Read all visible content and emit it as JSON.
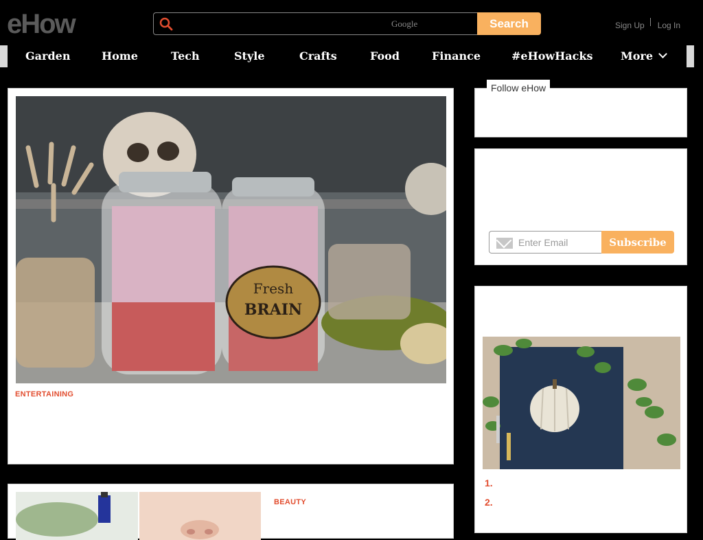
{
  "brand": {
    "logo_text": "eHow"
  },
  "search": {
    "engine_label": "Google",
    "button_label": "Search",
    "placeholder": ""
  },
  "account": {
    "sign_up": "Sign Up",
    "log_in": "Log In"
  },
  "nav": {
    "items": [
      "Garden",
      "Home",
      "Tech",
      "Style",
      "Crafts",
      "Food",
      "Finance",
      "#eHowHacks",
      "More"
    ]
  },
  "hero": {
    "category": "ENTERTAINING",
    "image_label_line1": "Fresh",
    "image_label_line2": "BRAIN"
  },
  "sidebar": {
    "follow_label": "Follow eHow",
    "email_placeholder": "Enter Email",
    "subscribe_label": "Subscribe",
    "list_numbers": [
      "1.",
      "2."
    ]
  },
  "second_card": {
    "category": "BEAUTY"
  },
  "colors": {
    "accent": "#f9b15f",
    "category_red": "#e24d2f",
    "background": "#000000"
  }
}
